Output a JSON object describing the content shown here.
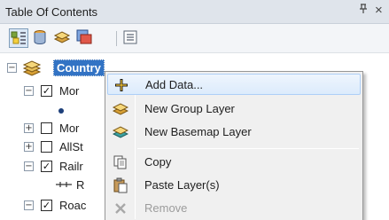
{
  "panel": {
    "title": "Table Of Contents",
    "pin_glyph": "ᵖ",
    "close_glyph": "×"
  },
  "toolbar": {
    "buttons": [
      {
        "name": "list-by-drawing-order",
        "icon": "list-by-drawing-order-icon",
        "active": true
      },
      {
        "name": "list-by-source",
        "icon": "database-icon"
      },
      {
        "name": "list-by-visibility",
        "icon": "layers-icon"
      },
      {
        "name": "list-by-selection",
        "icon": "selection-icon"
      },
      {
        "name": "options",
        "icon": "options-icon"
      }
    ]
  },
  "tree": {
    "items": [
      {
        "label": "Country",
        "expanded": true,
        "type": "data-frame"
      },
      {
        "label": "Mor",
        "checked": true,
        "expanded": true
      },
      {
        "label": "Mor",
        "checked": false,
        "expanded": false
      },
      {
        "label": "AllSt",
        "checked": false,
        "expanded": false
      },
      {
        "label": "Railr",
        "checked": true,
        "expanded": true
      },
      {
        "label": "R",
        "type": "legend-line"
      },
      {
        "label": "Roac",
        "checked": true,
        "expanded": true
      }
    ],
    "expand_minus": "−",
    "expand_plus": "+",
    "check_mark": "✓"
  },
  "context_menu": {
    "items": [
      {
        "label": "Add Data...",
        "icon": "add-data-icon",
        "hover": true
      },
      {
        "label": "New Group Layer",
        "icon": "group-layer-icon"
      },
      {
        "label": "New Basemap Layer",
        "icon": "basemap-layer-icon"
      },
      {
        "label": "Copy",
        "icon": "copy-icon"
      },
      {
        "label": "Paste Layer(s)",
        "icon": "paste-icon"
      },
      {
        "label": "Remove",
        "icon": "remove-icon",
        "disabled": true
      }
    ]
  },
  "colors": {
    "selection": "#3273c4",
    "menu_hover": "#dcebfc",
    "titlebar": "#dfe4eb"
  }
}
